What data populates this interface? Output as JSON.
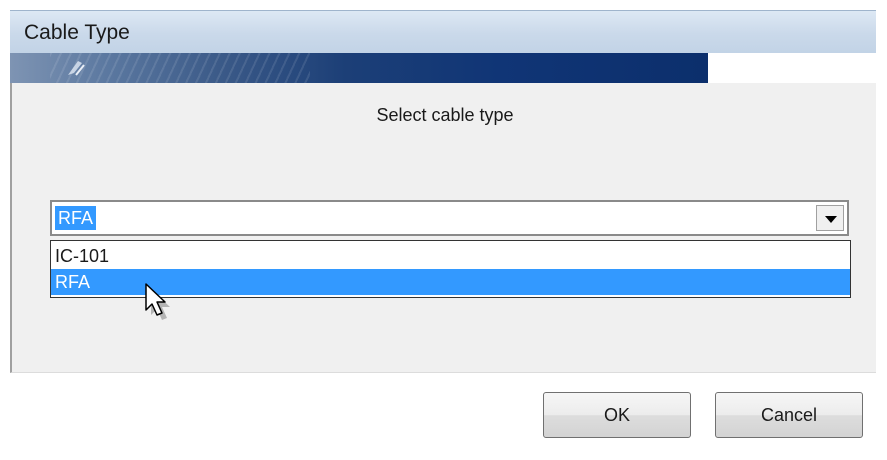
{
  "window": {
    "title": "Cable Type"
  },
  "prompt": "Select cable type",
  "combo": {
    "value": "RFA",
    "options": [
      "IC-101",
      "RFA"
    ],
    "highlighted_option": "RFA"
  },
  "buttons": {
    "ok_label": "OK",
    "cancel_label": "Cancel"
  },
  "icons": {
    "banner_logo": "logo-icon",
    "dropdown_arrow": "chevron-down-icon",
    "cursor": "mouse-pointer-icon"
  },
  "colors": {
    "selection": "#3399ff",
    "banner": "#103576",
    "panel": "#f0f0f0"
  }
}
